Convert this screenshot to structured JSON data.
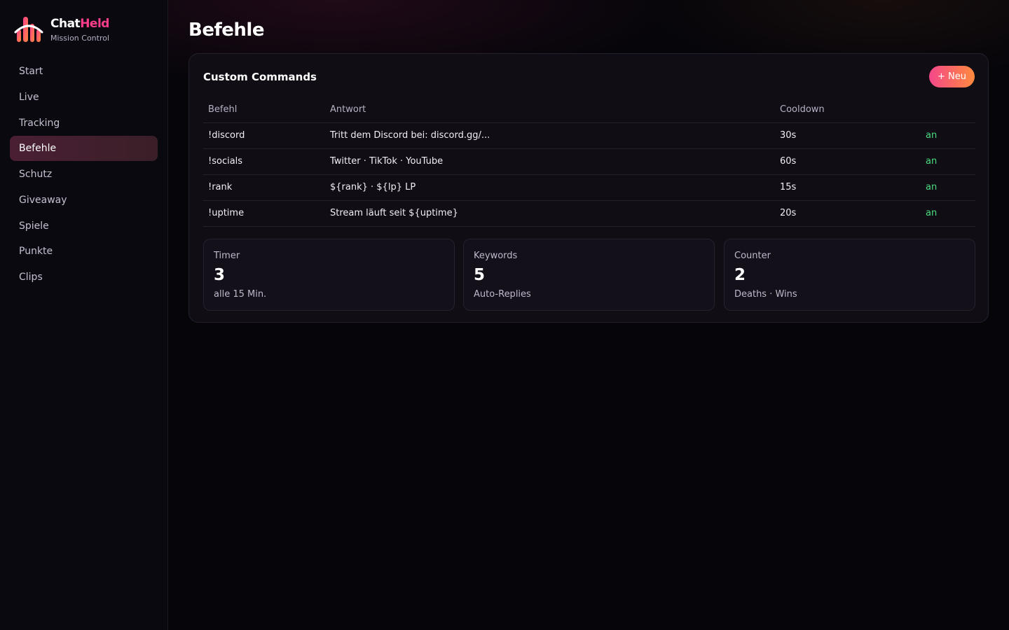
{
  "brand": {
    "name_part1": "Chat",
    "name_part2": "Held",
    "subtitle": "Mission Control"
  },
  "sidebar": {
    "items": [
      {
        "label": "Start",
        "active": false
      },
      {
        "label": "Live",
        "active": false
      },
      {
        "label": "Tracking",
        "active": false
      },
      {
        "label": "Befehle",
        "active": true
      },
      {
        "label": "Schutz",
        "active": false
      },
      {
        "label": "Giveaway",
        "active": false
      },
      {
        "label": "Spiele",
        "active": false
      },
      {
        "label": "Punkte",
        "active": false
      },
      {
        "label": "Clips",
        "active": false
      }
    ]
  },
  "page": {
    "title": "Befehle"
  },
  "commands_card": {
    "title": "Custom Commands",
    "new_button_label": "+ Neu",
    "columns": [
      "Befehl",
      "Antwort",
      "Cooldown",
      ""
    ],
    "rows": [
      {
        "command": "!discord",
        "response": "Tritt dem Discord bei: discord.gg/...",
        "cooldown": "30s",
        "status": "an"
      },
      {
        "command": "!socials",
        "response": "Twitter · TikTok · YouTube",
        "cooldown": "60s",
        "status": "an"
      },
      {
        "command": "!rank",
        "response": "${rank} · ${lp} LP",
        "cooldown": "15s",
        "status": "an"
      },
      {
        "command": "!uptime",
        "response": "Stream läuft seit ${uptime}",
        "cooldown": "20s",
        "status": "an"
      }
    ]
  },
  "stats": [
    {
      "label": "Timer",
      "value": "3",
      "sub": "alle 15 Min."
    },
    {
      "label": "Keywords",
      "value": "5",
      "sub": "Auto-Replies"
    },
    {
      "label": "Counter",
      "value": "2",
      "sub": "Deaths · Wins"
    }
  ],
  "colors": {
    "accent_pink": "#ff3d8b",
    "accent_orange": "#ff8a3d",
    "status_green": "#4ade80",
    "background": "#06050a"
  },
  "icons": {
    "logo": "chatheld-logo-icon"
  }
}
